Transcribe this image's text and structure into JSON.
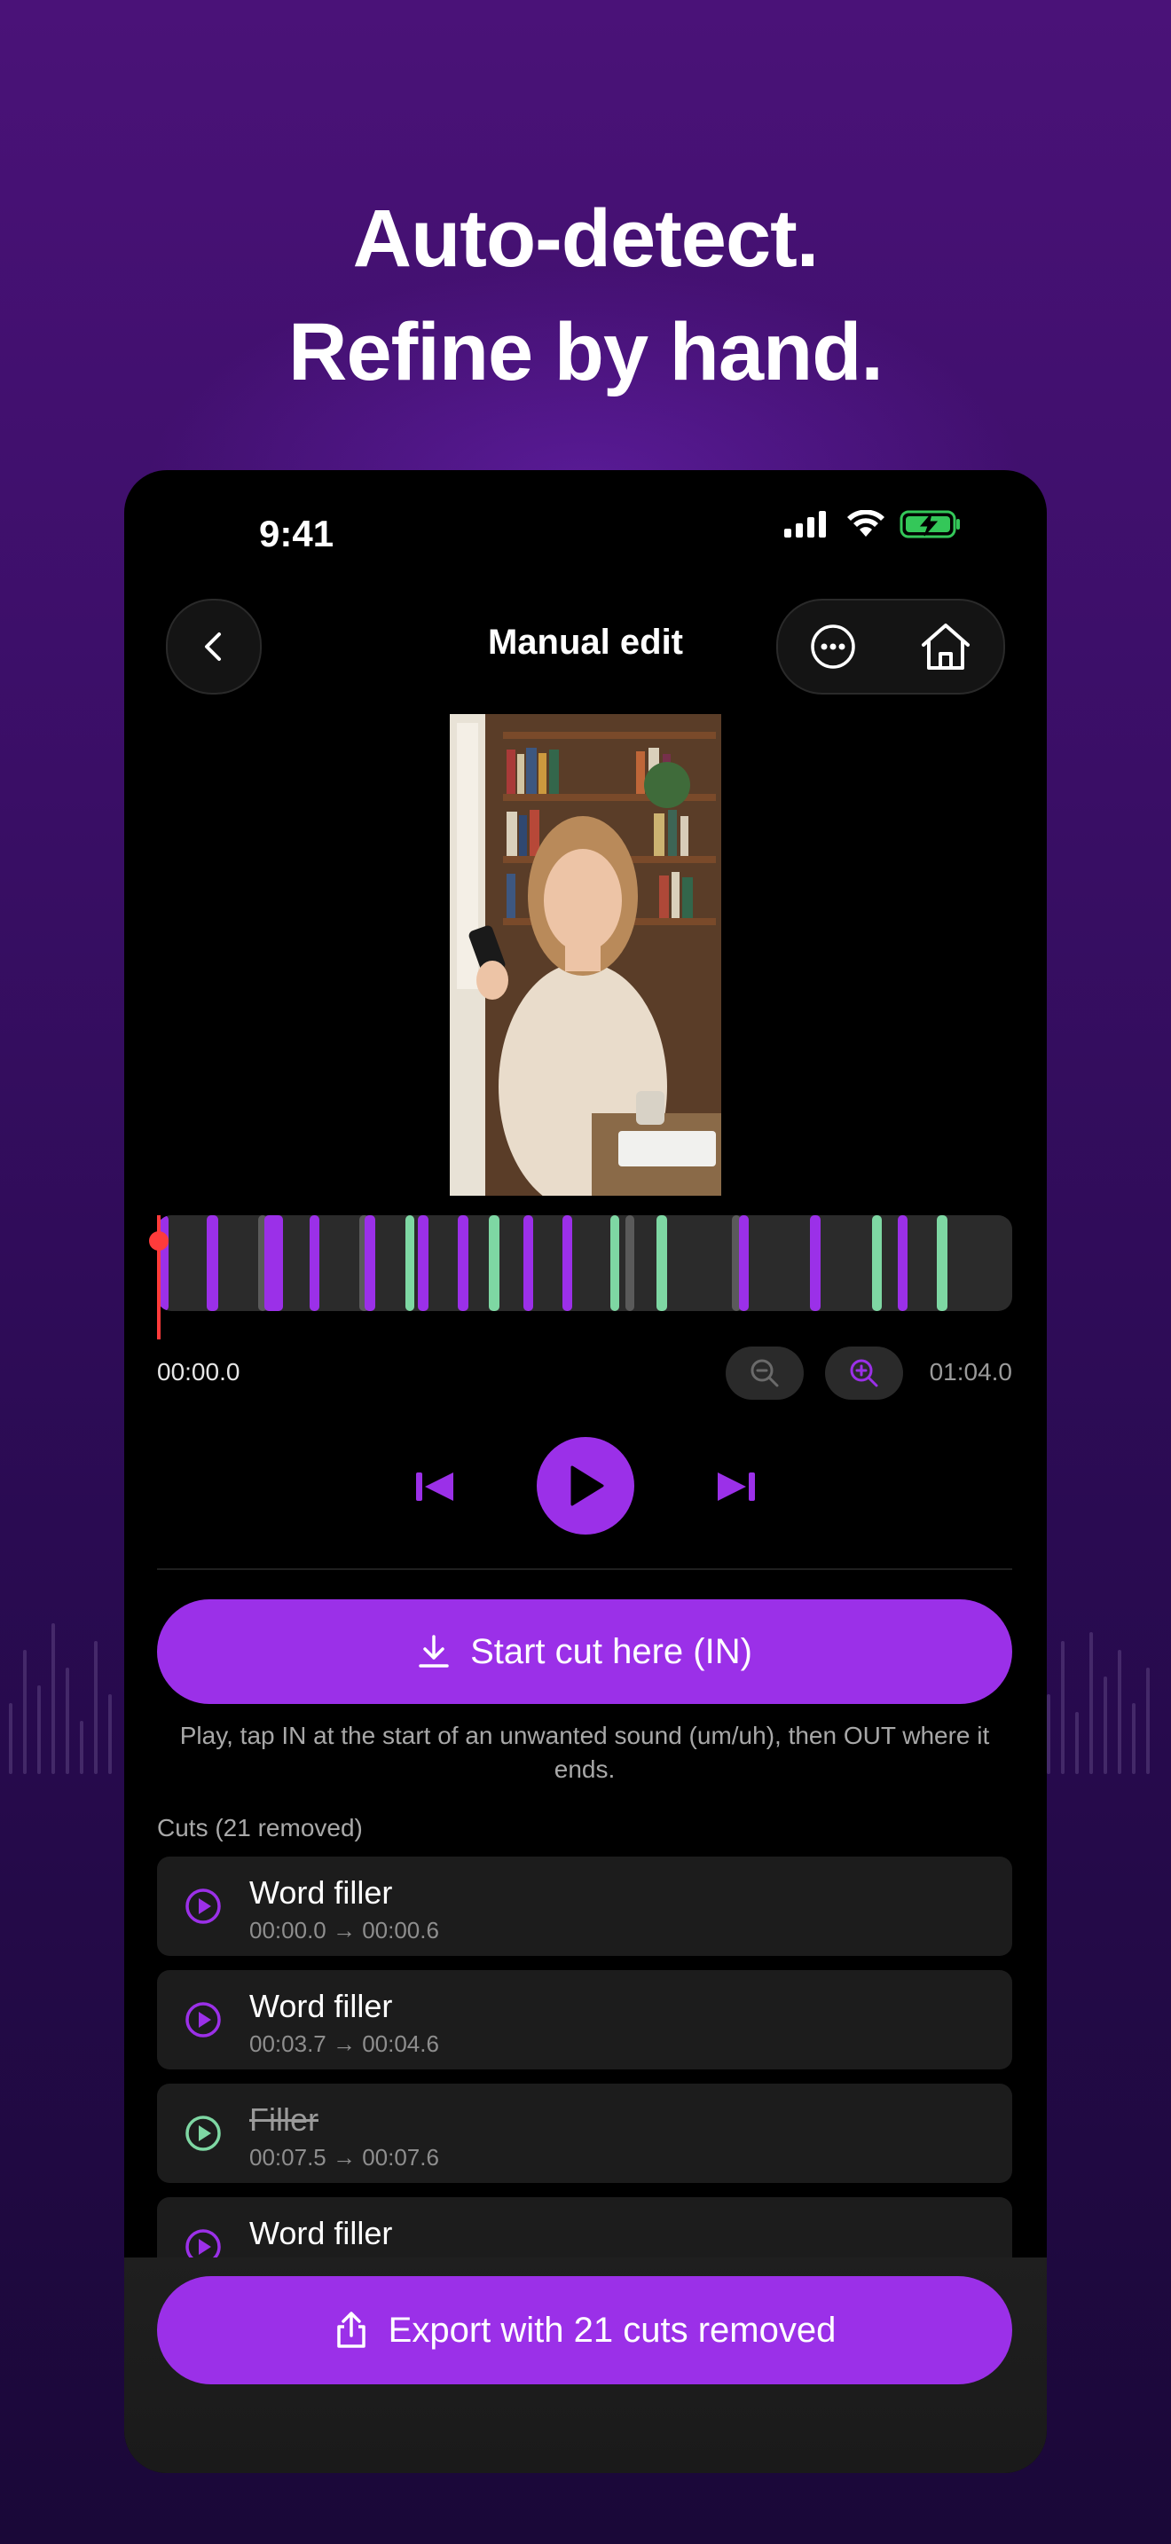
{
  "headline": {
    "line1": "Auto-detect.",
    "line2": "Refine by hand."
  },
  "status": {
    "time": "9:41",
    "icons": [
      "signal-icon",
      "wifi-icon",
      "battery-charging-icon"
    ]
  },
  "nav": {
    "title": "Manual edit",
    "back_icon": "chevron-left-icon",
    "more_icon": "ellipsis-circle-icon",
    "home_icon": "home-icon"
  },
  "timeline": {
    "current_time": "00:00.0",
    "total_time": "01:04.0",
    "zoom_out_icon": "zoom-out-icon",
    "zoom_in_icon": "zoom-in-icon",
    "playhead_fraction": 0.0,
    "colors": {
      "track": "#2b2b2b",
      "filler": "#9b30e8",
      "kept": "#7ed7a3",
      "playhead": "#ff3b3b"
    }
  },
  "player": {
    "prev_icon": "skip-back-icon",
    "play_icon": "play-icon",
    "next_icon": "skip-forward-icon"
  },
  "actions": {
    "in_label": "Start cut here (IN)",
    "in_icon": "download-icon",
    "hint": "Play, tap IN at the start of an unwanted sound (um/uh), then OUT where it ends.",
    "export_label": "Export with 21 cuts removed",
    "export_icon": "share-icon"
  },
  "cuts": {
    "label": "Cuts (21 removed)",
    "items": [
      {
        "title": "Word filler",
        "range": "00:00.0 → 00:00.6",
        "state": "removed"
      },
      {
        "title": "Word filler",
        "range": "00:03.7 → 00:04.6",
        "state": "removed"
      },
      {
        "title": "Filler",
        "range": "00:07.5 → 00:07.6",
        "state": "kept"
      },
      {
        "title": "Word filler",
        "range": "",
        "state": "removed"
      }
    ]
  },
  "colors": {
    "accent": "#9b30e8",
    "kept": "#7ed7a3",
    "background": "#000000"
  }
}
